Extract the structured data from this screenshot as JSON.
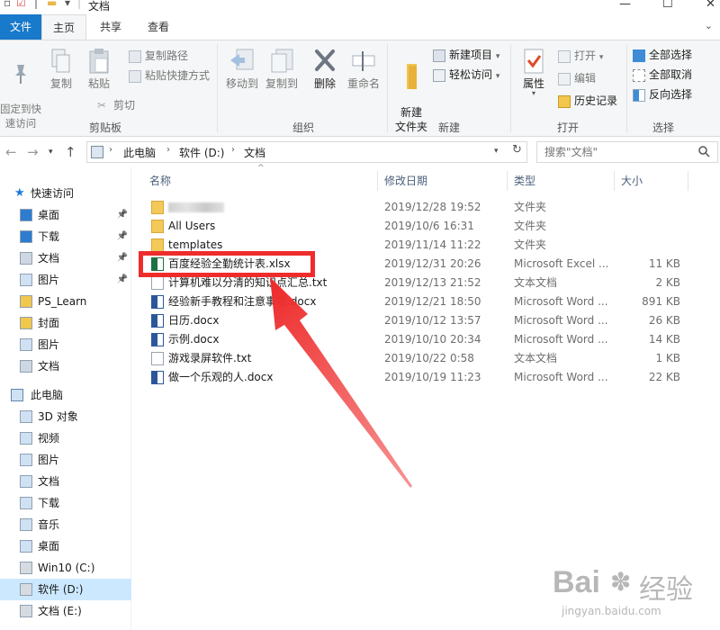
{
  "window": {
    "title": "文档",
    "minimize_glyph": "—",
    "maximize_glyph": "☐",
    "close_glyph": "✕"
  },
  "ribbon_tabs": [
    {
      "label": "文件",
      "active": false
    },
    {
      "label": "主页",
      "active": true
    },
    {
      "label": "共享",
      "active": false
    },
    {
      "label": "查看",
      "active": false
    }
  ],
  "ribbon": {
    "clipboard": {
      "pin_quick_access": "固定到快\n速访问",
      "copy": "复制",
      "paste": "粘贴",
      "copy_path": "复制路径",
      "paste_shortcut": "粘贴快捷方式",
      "cut": "剪切",
      "group_label": "剪贴板"
    },
    "organize": {
      "move_to": "移动到",
      "copy_to": "复制到",
      "delete": "删除",
      "rename": "重命名",
      "group_label": "组织"
    },
    "new": {
      "new_folder": "新建\n文件夹",
      "new_item": "新建项目",
      "easy_access": "轻松访问",
      "group_label": "新建"
    },
    "open": {
      "properties": "属性",
      "open": "打开",
      "edit": "编辑",
      "history": "历史记录",
      "group_label": "打开"
    },
    "select": {
      "select_all": "全部选择",
      "select_none": "全部取消",
      "invert_selection": "反向选择",
      "group_label": "选择"
    }
  },
  "address": {
    "crumbs": [
      "此电脑",
      "软件 (D:)",
      "文档"
    ],
    "search_placeholder": "搜索\"文档\""
  },
  "nav_pane": {
    "quick_access": "快速访问",
    "items_quick": [
      {
        "label": "桌面",
        "pinned": true
      },
      {
        "label": "下载",
        "pinned": true
      },
      {
        "label": "文档",
        "pinned": true
      },
      {
        "label": "图片",
        "pinned": true
      },
      {
        "label": "PS_Learn",
        "pinned": false
      },
      {
        "label": "封面",
        "pinned": false
      },
      {
        "label": "图片",
        "pinned": false
      },
      {
        "label": "文档",
        "pinned": false
      }
    ],
    "this_pc": "此电脑",
    "items_pc": [
      {
        "label": "3D 对象"
      },
      {
        "label": "视频"
      },
      {
        "label": "图片"
      },
      {
        "label": "文档"
      },
      {
        "label": "下载"
      },
      {
        "label": "音乐"
      },
      {
        "label": "桌面"
      },
      {
        "label": "Win10 (C:)"
      },
      {
        "label": "软件 (D:)",
        "selected": true
      },
      {
        "label": "文档 (E:)"
      }
    ]
  },
  "columns": {
    "name": "名称",
    "date": "修改日期",
    "type": "类型",
    "size": "大小"
  },
  "files": [
    {
      "name": "",
      "date": "2019/12/28 19:52",
      "type": "文件夹",
      "size": "",
      "icon": "folder-icon",
      "blurred": true
    },
    {
      "name": "All Users",
      "date": "2019/10/6 16:31",
      "type": "文件夹",
      "size": "",
      "icon": "folder-icon"
    },
    {
      "name": "templates",
      "date": "2019/11/14 11:22",
      "type": "文件夹",
      "size": "",
      "icon": "folder-icon"
    },
    {
      "name": "百度经验全勤统计表.xlsx",
      "date": "2019/12/31 20:26",
      "type": "Microsoft Excel ...",
      "size": "11 KB",
      "icon": "excel-file-icon",
      "highlighted": true
    },
    {
      "name": "计算机难以分清的知识点汇总.txt",
      "date": "2019/12/13 21:52",
      "type": "文本文档",
      "size": "2 KB",
      "icon": "text-file-icon"
    },
    {
      "name": "经验新手教程和注意事项.docx",
      "date": "2019/12/21 18:50",
      "type": "Microsoft Word ...",
      "size": "891 KB",
      "icon": "word-file-icon"
    },
    {
      "name": "日历.docx",
      "date": "2019/10/12 13:57",
      "type": "Microsoft Word ...",
      "size": "26 KB",
      "icon": "word-file-icon"
    },
    {
      "name": "示例.docx",
      "date": "2019/10/10 20:34",
      "type": "Microsoft Word ...",
      "size": "14 KB",
      "icon": "word-file-icon"
    },
    {
      "name": "游戏录屏软件.txt",
      "date": "2019/10/22 0:58",
      "type": "文本文档",
      "size": "1 KB",
      "icon": "text-file-icon"
    },
    {
      "name": "做一个乐观的人.docx",
      "date": "2019/10/19 11:23",
      "type": "Microsoft Word ...",
      "size": "22 KB",
      "icon": "word-file-icon"
    }
  ],
  "watermark": {
    "brand": "Bai",
    "brand_tail": "经验",
    "url": "jingyan.baidu.com"
  },
  "colors": {
    "file_tab": "#1979ca",
    "selection": "#cce8ff",
    "annotation": "#ee2c2c"
  }
}
